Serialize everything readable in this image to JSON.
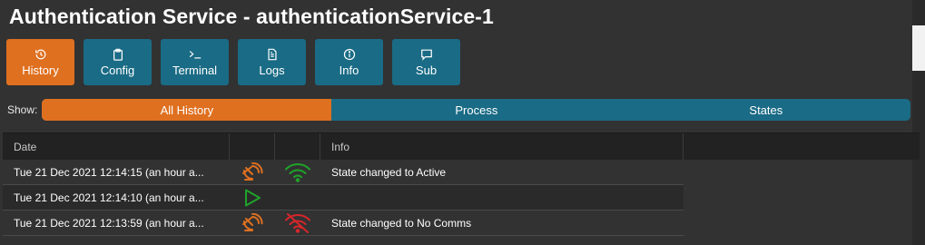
{
  "title": "Authentication Service - authenticationService-1",
  "toolbar": {
    "buttons": [
      {
        "label": "History",
        "icon": "history-icon",
        "active": true
      },
      {
        "label": "Config",
        "icon": "clipboard-icon",
        "active": false
      },
      {
        "label": "Terminal",
        "icon": "terminal-icon",
        "active": false
      },
      {
        "label": "Logs",
        "icon": "document-icon",
        "active": false
      },
      {
        "label": "Info",
        "icon": "info-icon",
        "active": false
      },
      {
        "label": "Sub",
        "icon": "message-icon",
        "active": false
      }
    ]
  },
  "show": {
    "label": "Show:",
    "options": [
      "All History",
      "Process",
      "States"
    ],
    "selected": "All History"
  },
  "table": {
    "columns": [
      "Date",
      "",
      "",
      "Info"
    ],
    "rows": [
      {
        "date": "Tue 21 Dec 2021 12:14:15 (an hour a...",
        "icon1": "satellite-dish-icon",
        "icon2": "wifi-icon",
        "info": "State changed to Active"
      },
      {
        "date": "Tue 21 Dec 2021 12:14:10 (an hour a...",
        "icon1": "play-icon",
        "icon2": "",
        "info": ""
      },
      {
        "date": "Tue 21 Dec 2021 12:13:59 (an hour a...",
        "icon1": "satellite-dish-icon",
        "icon2": "wifi-off-icon",
        "info": "State changed to No Comms"
      }
    ]
  },
  "colors": {
    "accent_orange": "#df7020",
    "button_teal": "#1a6b85",
    "icon_green": "#1fa32a",
    "icon_red": "#d6262b",
    "background": "#323232"
  }
}
